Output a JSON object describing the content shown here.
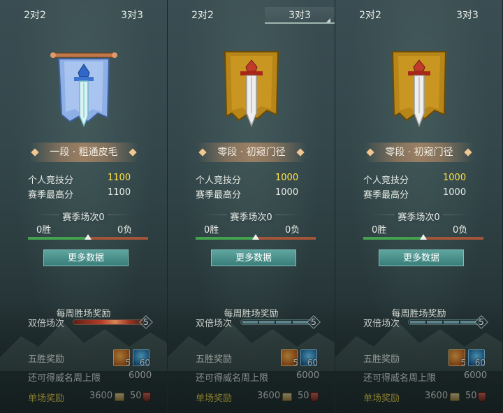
{
  "panels": [
    {
      "tab_left": "2对2",
      "tab_right": "3对3",
      "rank_title": "一段 · 粗通皮毛",
      "emblem": "blue-banner-icon",
      "personal_score_label": "个人竞技分",
      "personal_score": "1100",
      "season_high_label": "赛季最高分",
      "season_high": "1100",
      "season_games": "赛季场次0",
      "wins": "0胜",
      "losses": "0负",
      "win_ratio": 0.5,
      "more_data": "更多数据",
      "weekly_title": "每周胜场奖励",
      "double_label": "双倍场次",
      "double_max": "5",
      "double_progress_active": true,
      "five_win_label": "五胜奖励",
      "reward_orange_count": "5",
      "reward_blue_count": "60",
      "weekly_limit_label": "还可得威名周上限",
      "weekly_limit": "6000",
      "single_label": "单场奖励",
      "single_coin": "3600",
      "single_shield": "50"
    },
    {
      "tab_left": "2对2",
      "tab_right": "3对3",
      "rank_title": "零段 · 初窥门径",
      "emblem": "gold-banner-icon",
      "personal_score_label": "个人竞技分",
      "personal_score": "1000",
      "season_high_label": "赛季最高分",
      "season_high": "1000",
      "season_games": "赛季场次0",
      "wins": "0胜",
      "losses": "0负",
      "win_ratio": 0.5,
      "more_data": "更多数据",
      "weekly_title": "每周胜场奖励",
      "double_label": "双倍场次",
      "double_max": "5",
      "double_progress_active": false,
      "five_win_label": "五胜奖励",
      "reward_orange_count": "5",
      "reward_blue_count": "60",
      "weekly_limit_label": "还可得威名周上限",
      "weekly_limit": "6000",
      "single_label": "单场奖励",
      "single_coin": "3600",
      "single_shield": "50"
    },
    {
      "tab_left": "2对2",
      "tab_right": "3对3",
      "rank_title": "零段 · 初窥门径",
      "emblem": "gold-banner-icon",
      "personal_score_label": "个人竞技分",
      "personal_score": "1000",
      "season_high_label": "赛季最高分",
      "season_high": "1000",
      "season_games": "赛季场次0",
      "wins": "0胜",
      "losses": "0负",
      "win_ratio": 0.5,
      "more_data": "更多数据",
      "weekly_title": "每周胜场奖励",
      "double_label": "双倍场次",
      "double_max": "5",
      "double_progress_active": false,
      "five_win_label": "五胜奖励",
      "reward_orange_count": "5",
      "reward_blue_count": "60",
      "weekly_limit_label": "还可得威名周上限",
      "weekly_limit": "6000",
      "single_label": "单场奖励",
      "single_coin": "3600",
      "single_shield": "50"
    }
  ],
  "colors": {
    "highlight": "#ffe24a",
    "win_bar": "#44a24e",
    "loss_bar": "#a3553a",
    "button": "#4a918c"
  }
}
